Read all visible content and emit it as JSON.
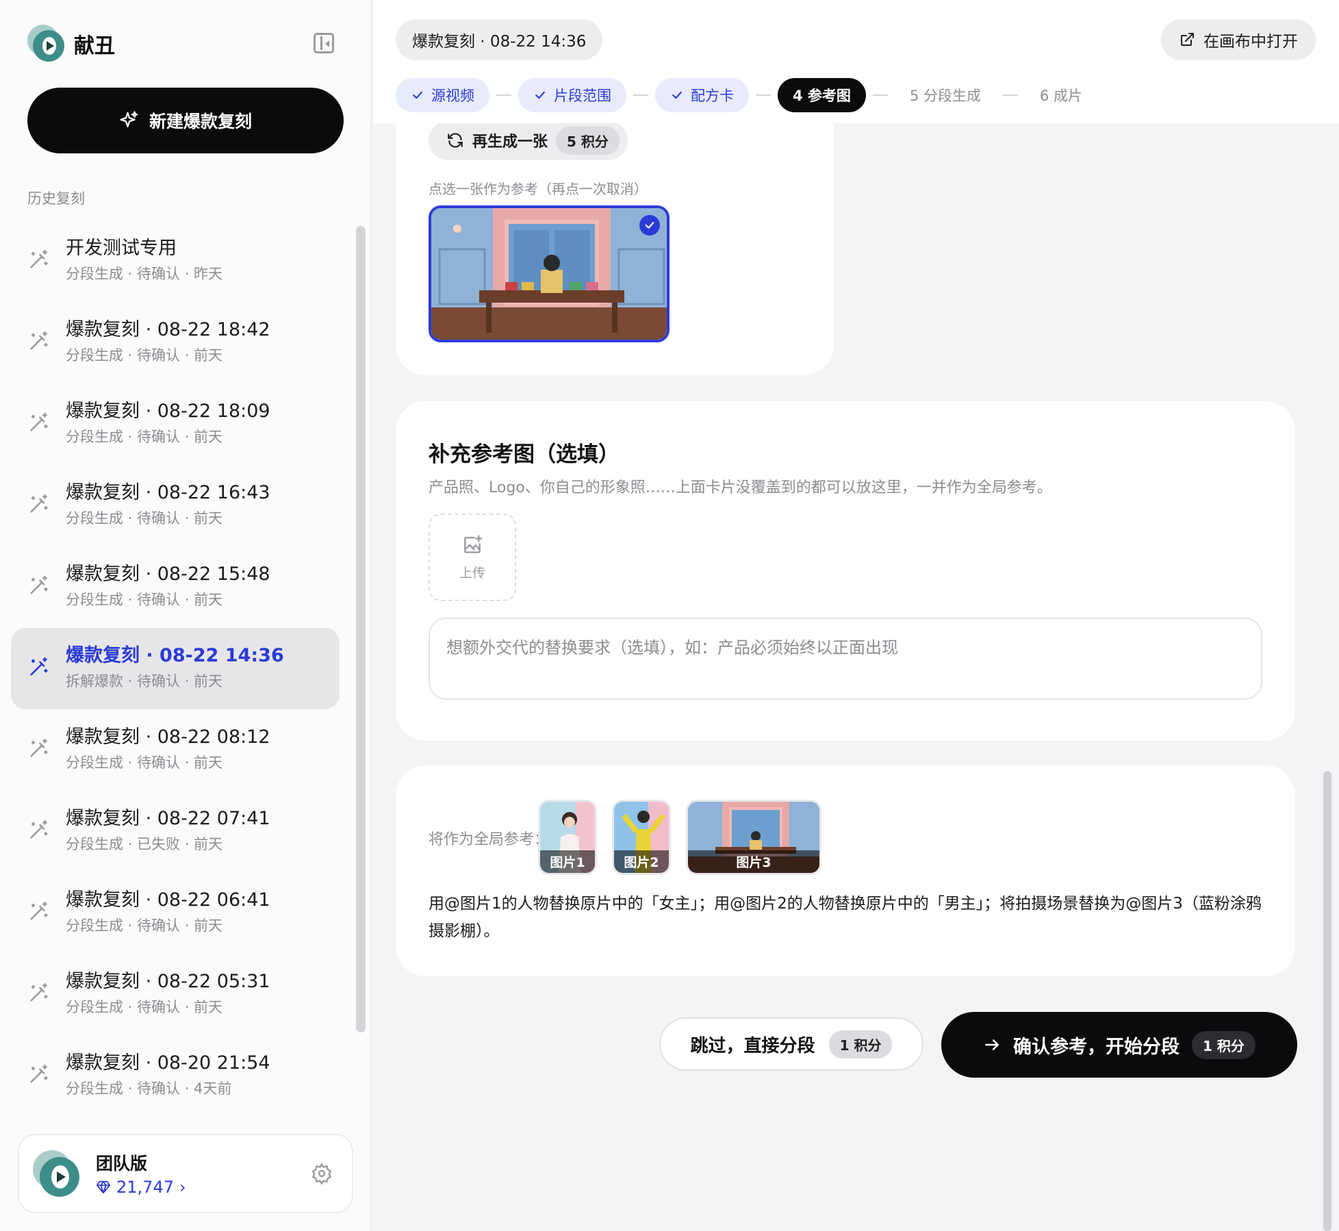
{
  "sidebar": {
    "brand_name": "献丑",
    "new_button_label": "新建爆款复刻",
    "history_label": "历史复刻",
    "items": [
      {
        "title": "开发测试专用",
        "subtitle": "分段生成 · 待确认 · 昨天"
      },
      {
        "title": "爆款复刻 · 08-22 18:42",
        "subtitle": "分段生成 · 待确认 · 前天"
      },
      {
        "title": "爆款复刻 · 08-22 18:09",
        "subtitle": "分段生成 · 待确认 · 前天"
      },
      {
        "title": "爆款复刻 · 08-22 16:43",
        "subtitle": "分段生成 · 待确认 · 前天"
      },
      {
        "title": "爆款复刻 · 08-22 15:48",
        "subtitle": "分段生成 · 待确认 · 前天"
      },
      {
        "title": "爆款复刻 · 08-22 14:36",
        "subtitle": "拆解爆款 · 待确认 · 前天",
        "active": true
      },
      {
        "title": "爆款复刻 · 08-22 08:12",
        "subtitle": "分段生成 · 待确认 · 前天"
      },
      {
        "title": "爆款复刻 · 08-22 07:41",
        "subtitle": "分段生成 · 已失败 · 前天"
      },
      {
        "title": "爆款复刻 · 08-22 06:41",
        "subtitle": "分段生成 · 待确认 · 前天"
      },
      {
        "title": "爆款复刻 · 08-22 05:31",
        "subtitle": "分段生成 · 待确认 · 前天"
      },
      {
        "title": "爆款复刻 · 08-20 21:54",
        "subtitle": "分段生成 · 待确认 · 4天前"
      }
    ],
    "account": {
      "plan": "团队版",
      "credits": "21,747",
      "chevron": "›"
    }
  },
  "header": {
    "title": "爆款复刻 · 08-22 14:36",
    "open_canvas_label": "在画布中打开"
  },
  "steps": [
    {
      "label": "源视频",
      "state": "done"
    },
    {
      "label": "片段范围",
      "state": "done"
    },
    {
      "label": "配方卡",
      "state": "done"
    },
    {
      "label": "4  参考图",
      "state": "current"
    },
    {
      "label": "5  分段生成",
      "state": "todo"
    },
    {
      "label": "6  成片",
      "state": "todo"
    }
  ],
  "reference": {
    "regen_label": "再生成一张",
    "regen_cost": "5 积分",
    "hint": "点选一张作为参考（再点一次取消）"
  },
  "supplement": {
    "title": "补充参考图（选填）",
    "description": "产品照、Logo、你自己的形象照……上面卡片没覆盖到的都可以放这里，一并作为全局参考。",
    "upload_label": "上传",
    "input_placeholder": "想额外交代的替换要求（选填），如：产品必须始终以正面出现"
  },
  "global": {
    "label": "将作为全局参考：",
    "thumbs": [
      "图片1",
      "图片2",
      "图片3"
    ],
    "instruction": "用@图片1的人物替换原片中的「女主」；用@图片2的人物替换原片中的「男主」；将拍摄场景替换为@图片3（蓝粉涂鸦摄影棚）。"
  },
  "actions": {
    "skip_label": "跳过，直接分段",
    "skip_cost": "1 积分",
    "confirm_label": "确认参考，开始分段",
    "confirm_cost": "1 积分"
  },
  "colors": {
    "accent": "#2b3bd8",
    "primary_button": "#0b0b0d",
    "done_step_bg": "#e8ebfb"
  },
  "icons": {
    "history_item": "magic-wand-icon",
    "new_button": "sparkle-icon",
    "regen": "refresh-icon",
    "open_canvas": "external-link-icon",
    "upload": "image-plus-icon",
    "confirm": "arrow-right-icon",
    "settings": "gear-icon",
    "credits": "diamond-icon"
  }
}
